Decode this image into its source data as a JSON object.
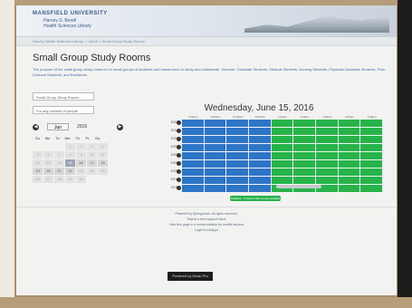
{
  "banner": {
    "university": "MANSFIELD UNIVERSITY",
    "library_line1": "Harvey S. Borell",
    "library_line2": "Health Sciences Library"
  },
  "breadcrumb": "Harvey Health Sciences Library  >  LibCal  >  Small Group Study Rooms",
  "page": {
    "title": "Small Group Study Rooms",
    "description": "The purpose of the small group study rooms is for small groups of students and researchers to study and collaborate. Summer: Graduate Students, Medical Students, Nursing Students, Physician Assistant Students, Post-Doctoral Students, and Residents."
  },
  "selects": {
    "room_group": "Small Group Study Rooms",
    "people": "For any number of people"
  },
  "calendar": {
    "month": "Jun",
    "year": "2016",
    "prev": "◀",
    "next": "▶",
    "weekdays": [
      "Su",
      "Mo",
      "Tu",
      "We",
      "Th",
      "Fr",
      "Sa"
    ],
    "days": [
      {
        "d": "",
        "state": "blank"
      },
      {
        "d": "",
        "state": "blank"
      },
      {
        "d": "",
        "state": "blank"
      },
      {
        "d": "1",
        "state": "past"
      },
      {
        "d": "2",
        "state": "past"
      },
      {
        "d": "3",
        "state": "past"
      },
      {
        "d": "4",
        "state": "past"
      },
      {
        "d": "5",
        "state": "past"
      },
      {
        "d": "6",
        "state": "past"
      },
      {
        "d": "7",
        "state": "past"
      },
      {
        "d": "8",
        "state": "past"
      },
      {
        "d": "9",
        "state": "past"
      },
      {
        "d": "10",
        "state": "past"
      },
      {
        "d": "11",
        "state": "past"
      },
      {
        "d": "12",
        "state": "past"
      },
      {
        "d": "13",
        "state": "past"
      },
      {
        "d": "14",
        "state": "past"
      },
      {
        "d": "15",
        "state": "selected"
      },
      {
        "d": "16",
        "state": "avail"
      },
      {
        "d": "17",
        "state": "avail"
      },
      {
        "d": "18",
        "state": "avail"
      },
      {
        "d": "19",
        "state": "avail"
      },
      {
        "d": "20",
        "state": "avail"
      },
      {
        "d": "21",
        "state": "avail"
      },
      {
        "d": "22",
        "state": "avail"
      },
      {
        "d": "23",
        "state": "past"
      },
      {
        "d": "24",
        "state": "past"
      },
      {
        "d": "25",
        "state": "past"
      },
      {
        "d": "26",
        "state": "past"
      },
      {
        "d": "27",
        "state": "past"
      },
      {
        "d": "28",
        "state": "past"
      },
      {
        "d": "29",
        "state": "past"
      },
      {
        "d": "30",
        "state": "past"
      },
      {
        "d": "",
        "state": "blank"
      },
      {
        "d": "",
        "state": "blank"
      }
    ]
  },
  "schedule": {
    "date_title": "Wednesday, June 15, 2016",
    "times": [
      "9:00am",
      "10:00am",
      "11:00am",
      "12:00pm",
      "1:00pm",
      "2:00pm",
      "3:00pm",
      "4:00pm",
      "5:00pm"
    ],
    "rooms": [
      {
        "name": "E303",
        "slots": [
          "b",
          "b",
          "b",
          "b",
          "o",
          "o",
          "o",
          "o",
          "o"
        ]
      },
      {
        "name": "E304",
        "slots": [
          "b",
          "b",
          "b",
          "b",
          "o",
          "o",
          "o",
          "o",
          "o"
        ]
      },
      {
        "name": "E305",
        "slots": [
          "b",
          "b",
          "b",
          "b",
          "o",
          "o",
          "o",
          "o",
          "o"
        ]
      },
      {
        "name": "E306",
        "slots": [
          "b",
          "b",
          "b",
          "b",
          "o",
          "o",
          "o",
          "o",
          "o"
        ]
      },
      {
        "name": "E307",
        "slots": [
          "b",
          "b",
          "b",
          "b",
          "o",
          "o",
          "o",
          "o",
          "o"
        ]
      },
      {
        "name": "E308",
        "slots": [
          "b",
          "b",
          "b",
          "b",
          "o",
          "o",
          "o",
          "o",
          "o"
        ]
      },
      {
        "name": "E309",
        "slots": [
          "b",
          "b",
          "b",
          "b",
          "o",
          "o",
          "o",
          "o",
          "o"
        ]
      },
      {
        "name": "E310",
        "slots": [
          "b",
          "b",
          "b",
          "b",
          "o",
          "o",
          "o",
          "o",
          "o"
        ]
      },
      {
        "name": "E311",
        "slots": [
          "b",
          "b",
          "b",
          "b",
          "o",
          "o",
          "o",
          "o",
          "o"
        ]
      }
    ],
    "submit_label": "Available · To book, click on any available slot",
    "colors": {
      "booked": "#2f75c7",
      "open": "#27b34a"
    }
  },
  "footer": {
    "line1": "Powered by Springshare. All rights reserved.",
    "line2": "Report a tech support issue",
    "line3": "View this page in a format suitable for mobile devices",
    "line4": "Login to LibApps"
  },
  "kiosk": "Powered by Kiosk Pro"
}
